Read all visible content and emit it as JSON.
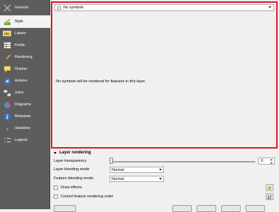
{
  "sidebar": {
    "items": [
      {
        "label": "General",
        "icon": "general-tools-icon"
      },
      {
        "label": "Style",
        "icon": "style-brush-icon",
        "selected": true
      },
      {
        "label": "Labels",
        "icon": "labels-abc-icon"
      },
      {
        "label": "Fields",
        "icon": "fields-table-icon"
      },
      {
        "label": "Rendering",
        "icon": "rendering-brush-icon"
      },
      {
        "label": "Display",
        "icon": "display-tooltip-icon"
      },
      {
        "label": "Actions",
        "icon": "actions-gear-icon"
      },
      {
        "label": "Joins",
        "icon": "joins-icon"
      },
      {
        "label": "Diagrams",
        "icon": "diagrams-pie-icon"
      },
      {
        "label": "Metadata",
        "icon": "metadata-info-icon"
      },
      {
        "label": "Variables",
        "icon": "variables-icon"
      },
      {
        "label": "Legend",
        "icon": "legend-icon"
      }
    ]
  },
  "style": {
    "renderer_value": "No symbols",
    "message": "No symbols will be rendered for features in this layer."
  },
  "layer_rendering": {
    "title": "Layer rendering",
    "transparency_label": "Layer transparency",
    "transparency_value": "0",
    "blending_label": "Layer blending mode",
    "blending_value": "Normal",
    "feature_blending_label": "Feature blending mode",
    "feature_blending_value": "Normal",
    "draw_effects_label": "Draw effects",
    "control_order_label": "Control feature rendering order"
  },
  "colors": {
    "highlight_border": "#e0121b",
    "sidebar_bg": "#5d5d5d"
  }
}
